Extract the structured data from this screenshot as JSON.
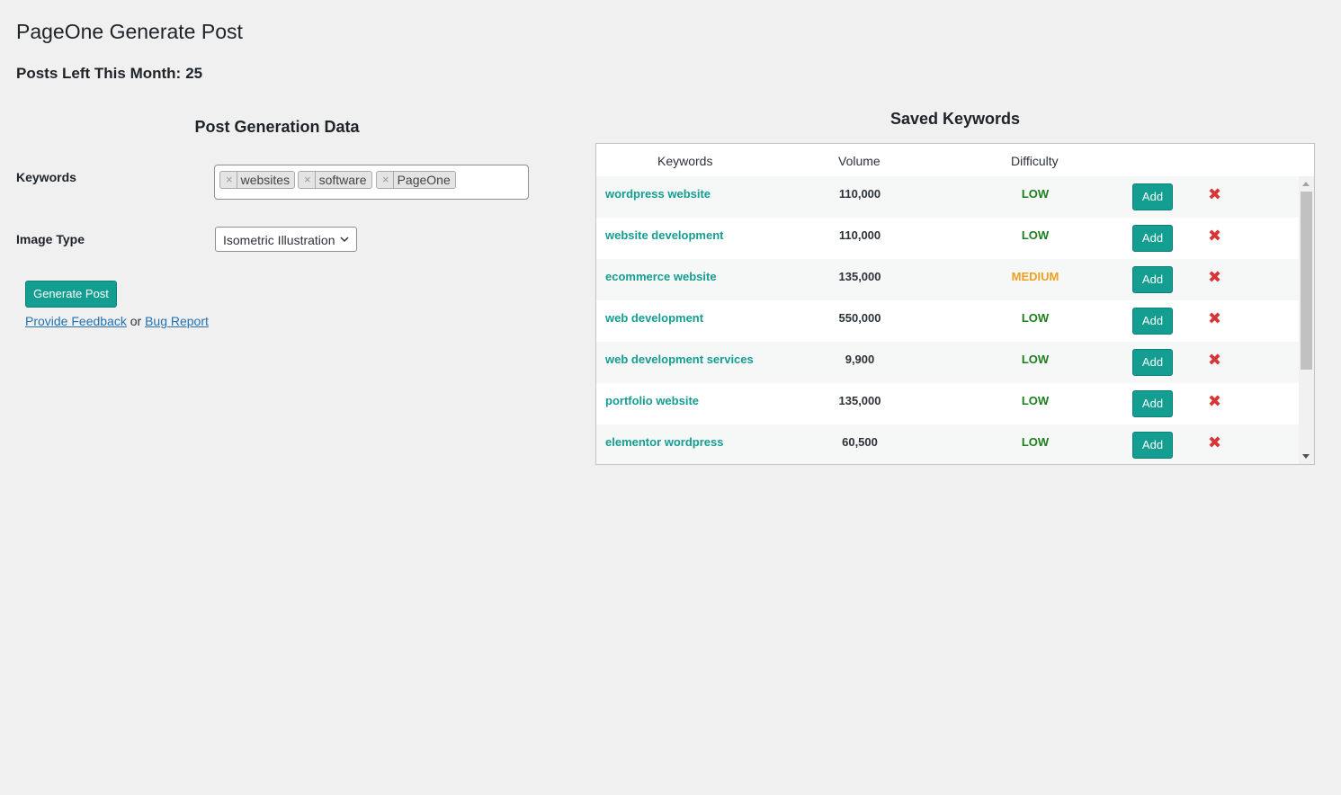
{
  "page": {
    "title": "PageOne Generate Post",
    "posts_left_label": "Posts Left This Month:",
    "posts_left_value": "25"
  },
  "form": {
    "section_title": "Post Generation Data",
    "keywords_label": "Keywords",
    "tags": [
      "websites",
      "software",
      "PageOne"
    ],
    "tag_remove": "×",
    "image_type_label": "Image Type",
    "image_type_value": "Isometric Illustration",
    "generate_label": "Generate Post",
    "feedback_link": "Provide Feedback",
    "or_text": "or",
    "bug_link": "Bug Report"
  },
  "saved": {
    "section_title": "Saved Keywords",
    "headers": {
      "keywords": "Keywords",
      "volume": "Volume",
      "difficulty": "Difficulty"
    },
    "add_label": "Add",
    "delete_glyph": "✖",
    "rows": [
      {
        "keyword": "wordpress website",
        "volume": "110,000",
        "difficulty": "LOW"
      },
      {
        "keyword": "website development",
        "volume": "110,000",
        "difficulty": "LOW"
      },
      {
        "keyword": "ecommerce website",
        "volume": "135,000",
        "difficulty": "MEDIUM"
      },
      {
        "keyword": "web development",
        "volume": "550,000",
        "difficulty": "LOW"
      },
      {
        "keyword": "web development services",
        "volume": "9,900",
        "difficulty": "LOW"
      },
      {
        "keyword": "portfolio website",
        "volume": "135,000",
        "difficulty": "LOW"
      },
      {
        "keyword": "elementor wordpress",
        "volume": "60,500",
        "difficulty": "LOW"
      }
    ]
  },
  "colors": {
    "accent": "#139e91",
    "low": "#1e7e1e",
    "medium": "#f0a020",
    "delete": "#d63638"
  }
}
